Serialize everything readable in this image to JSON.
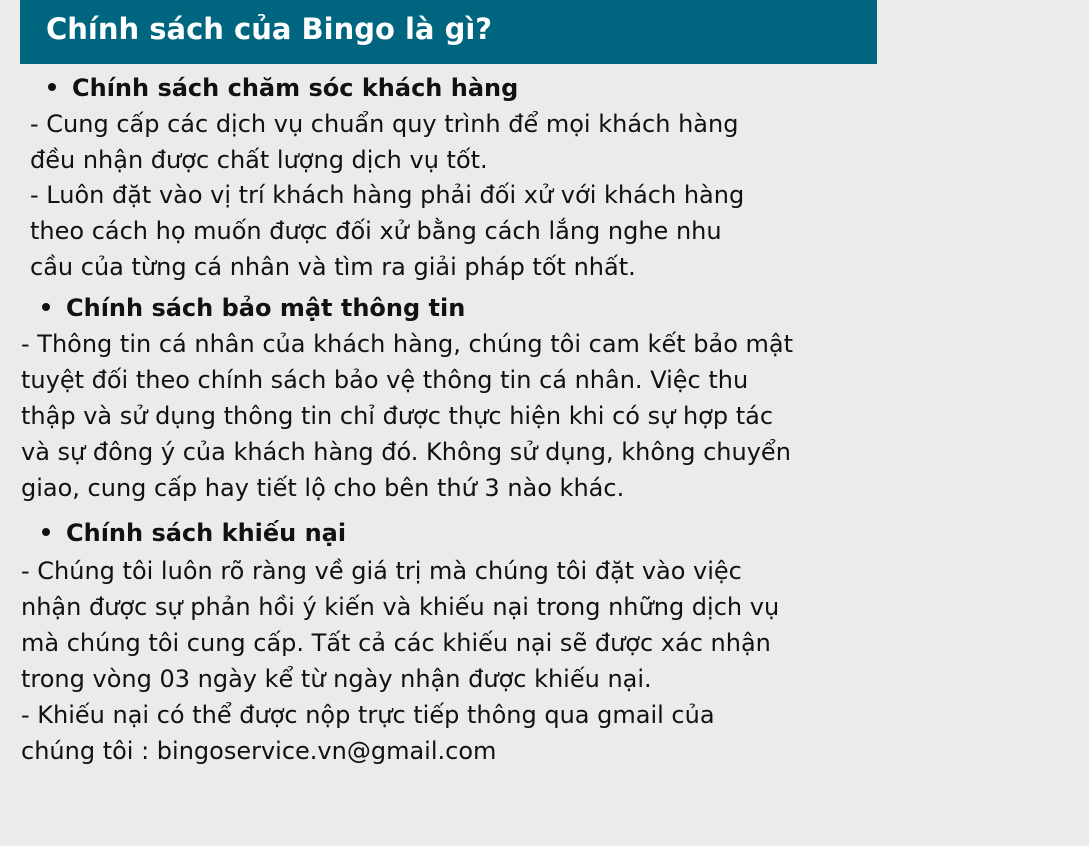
{
  "title": "Chính sách của Bingo là gì?",
  "sections": [
    {
      "heading": "Chính sách chăm sóc khách hàng",
      "paragraphs": [
        {
          "lines": [
            "- Cung cấp các dịch vụ chuẩn quy trình để mọi khách hàng",
            "đều nhận được chất lượng dịch vụ tốt."
          ]
        },
        {
          "lines": [
            "- Luôn đặt vào vị trí khách hàng phải đối xử với khách hàng",
            "theo cách họ muốn được đối xử bằng cách lắng nghe nhu",
            "cầu của từng cá nhân và tìm ra giải pháp tốt nhất."
          ]
        }
      ]
    },
    {
      "heading": "Chính sách bảo mật thông tin",
      "paragraphs": [
        {
          "lines": [
            "- Thông tin cá nhân của khách hàng, chúng tôi cam kết bảo mật",
            "tuyệt đối theo chính sách bảo vệ thông tin cá nhân. Việc thu",
            "thập và sử dụng thông tin chỉ được thực hiện khi có sự hợp tác",
            "và sự đông ý của khách hàng đó. Không sử dụng, không chuyển",
            "giao, cung cấp hay tiết lộ cho bên thứ 3 nào khác."
          ]
        }
      ]
    },
    {
      "heading": "Chính sách khiếu nại",
      "paragraphs": [
        {
          "lines": [
            "- Chúng tôi luôn rõ ràng về giá trị mà chúng tôi đặt vào việc",
            "nhận được sự phản hồi ý kiến và khiếu nại trong những dịch vụ",
            "mà chúng tôi cung cấp. Tất cả các khiếu nại sẽ được xác nhận",
            "trong vòng 03 ngày kể từ ngày nhận được khiếu nại."
          ]
        },
        {
          "lines": [
            "- Khiếu nại có thể được nộp trực tiếp thông qua gmail của",
            "chúng tôi : bingoservice.vn@gmail.com"
          ]
        }
      ]
    }
  ],
  "colors": {
    "background": "#ebebeb",
    "title_bar": "#006680",
    "title_text": "#ffffff",
    "body_text": "#111111"
  }
}
